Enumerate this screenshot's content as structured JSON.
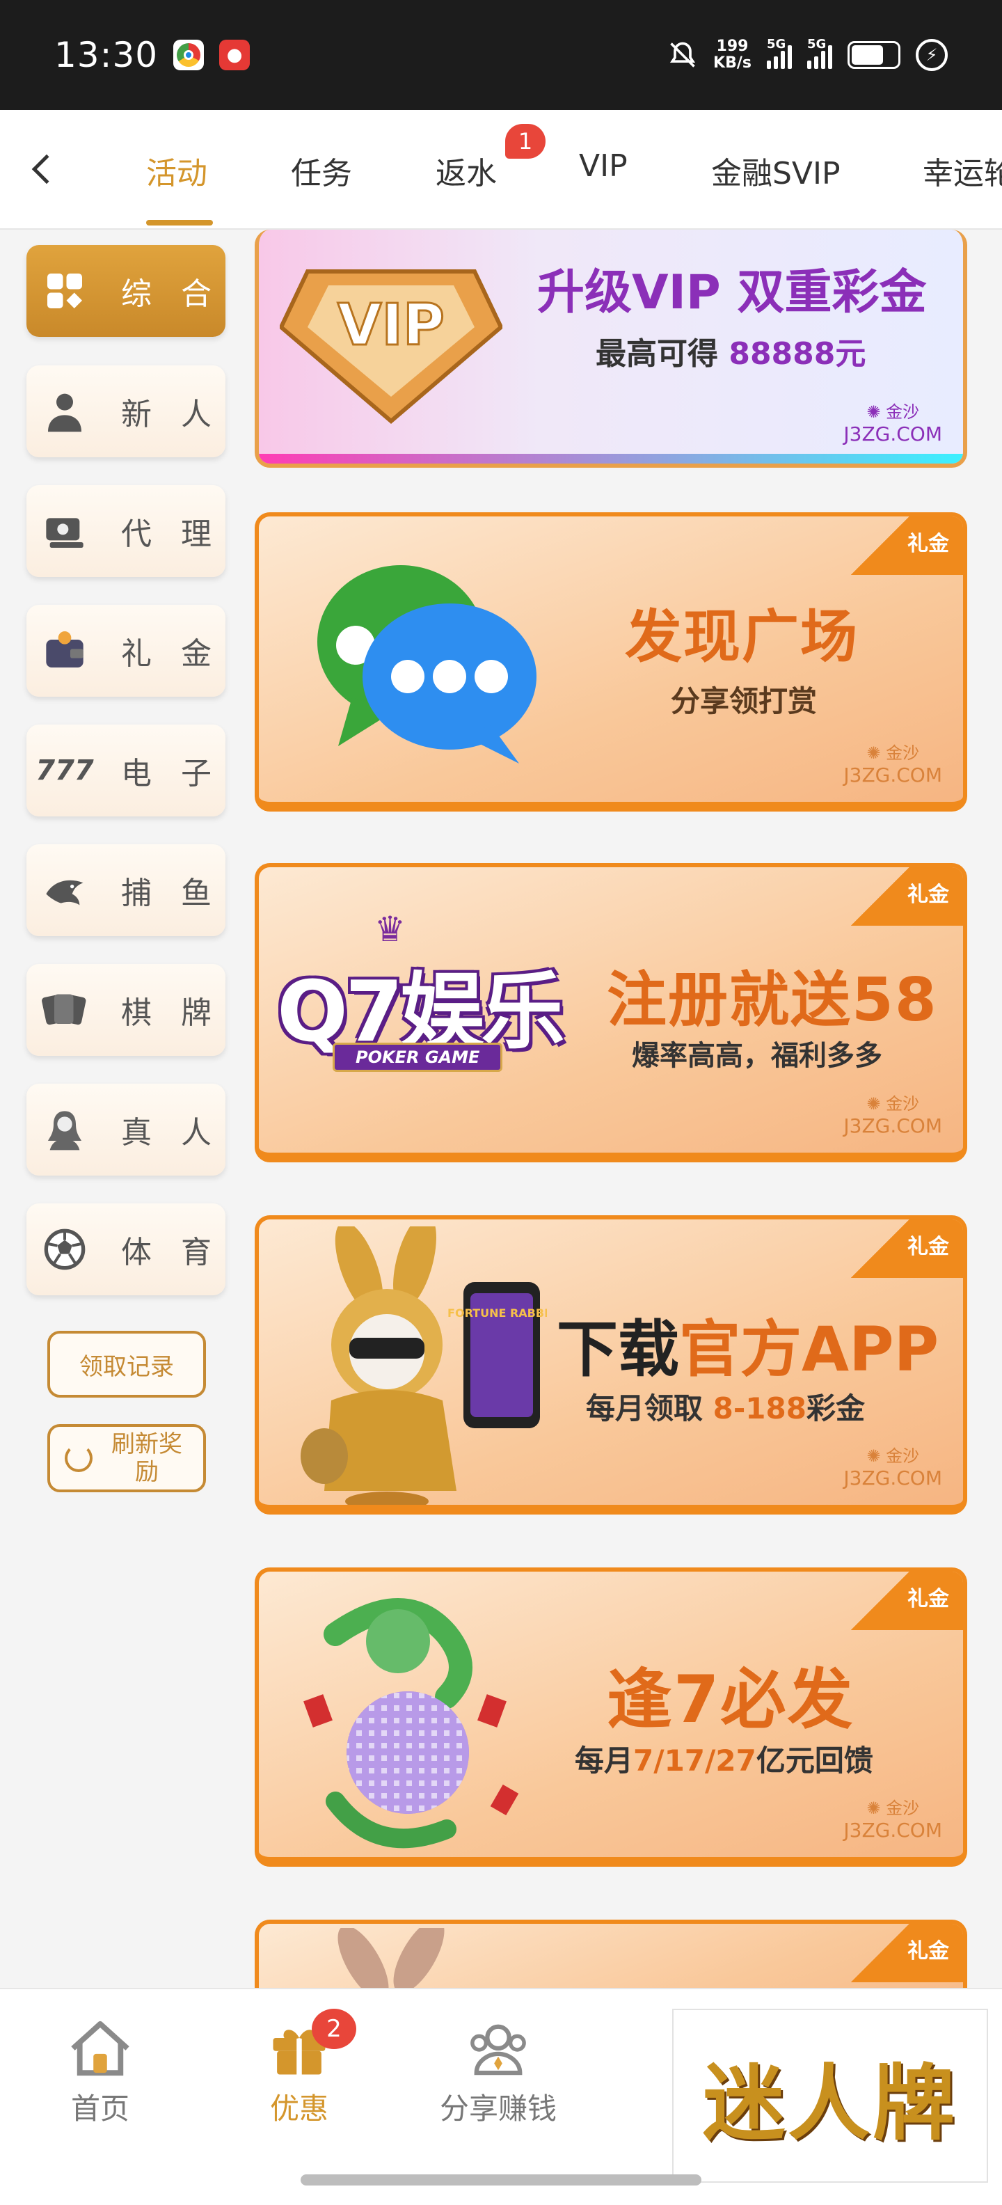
{
  "status_bar": {
    "time": "13:30",
    "speed_value": "199",
    "speed_unit": "KB/s",
    "sim1": "5G",
    "sim2": "5G"
  },
  "tabs": [
    {
      "label": "活动",
      "active": true
    },
    {
      "label": "任务"
    },
    {
      "label": "返水",
      "badge": "1"
    },
    {
      "label": "VIP"
    },
    {
      "label": "金融SVIP"
    },
    {
      "label": "幸运轮"
    }
  ],
  "sidebar": {
    "items": [
      {
        "label": "综 合",
        "icon": "grid-icon",
        "active": true
      },
      {
        "label": "新 人",
        "icon": "person-icon"
      },
      {
        "label": "代 理",
        "icon": "money-icon"
      },
      {
        "label": "礼 金",
        "icon": "wallet-icon"
      },
      {
        "label": "电 子",
        "icon": "slot-777-icon"
      },
      {
        "label": "捕 鱼",
        "icon": "shark-icon"
      },
      {
        "label": "棋 牌",
        "icon": "cards-icon"
      },
      {
        "label": "真 人",
        "icon": "lady-icon"
      },
      {
        "label": "体 育",
        "icon": "soccer-ball-icon"
      }
    ],
    "record_button": "领取记录",
    "refresh_button": "刷新奖励"
  },
  "banners": [
    {
      "type": "vip",
      "gem_text": "VIP",
      "title": "升级VIP 双重彩金",
      "sub_prefix": "最高可得 ",
      "sub_highlight": "88888元",
      "brand_name": "金沙",
      "brand_url": "J3ZG.COM"
    },
    {
      "ribbon": "礼金",
      "title": "发现广场",
      "sub": "分享领打赏",
      "brand_name": "金沙",
      "brand_url": "J3ZG.COM"
    },
    {
      "ribbon": "礼金",
      "logo_text": "Q7娱乐",
      "logo_sub": "POKER GAME",
      "title": "注册就送58",
      "sub": "爆率高高，福利多多",
      "brand_name": "金沙",
      "brand_url": "J3ZG.COM"
    },
    {
      "ribbon": "礼金",
      "title_dark": "下载",
      "title": "官方APP",
      "sub_prefix": "每月领取 ",
      "sub_highlight": "8-188",
      "sub_suffix": "彩金",
      "phone_text": "FORTUNE RABBIT",
      "brand_name": "金沙",
      "brand_url": "J3ZG.COM"
    },
    {
      "ribbon": "礼金",
      "title": "逢7必发",
      "sub_prefix": "每月",
      "sub_highlight": "7/17/27",
      "sub_suffix": "亿元回馈",
      "brand_name": "金沙",
      "brand_url": "J3ZG.COM"
    },
    {
      "ribbon": "礼金"
    }
  ],
  "bottom_nav": [
    {
      "label": "首页",
      "icon": "home-icon"
    },
    {
      "label": "优惠",
      "icon": "gift-icon",
      "active": true,
      "badge": "2"
    },
    {
      "label": "分享赚钱",
      "icon": "share-users-icon"
    }
  ],
  "ad": {
    "text": "迷人牌"
  },
  "colors": {
    "accent": "#d4962c",
    "orange": "#f08a1c",
    "badge": "#e8463a",
    "vip_purple": "#8b2fb8"
  }
}
